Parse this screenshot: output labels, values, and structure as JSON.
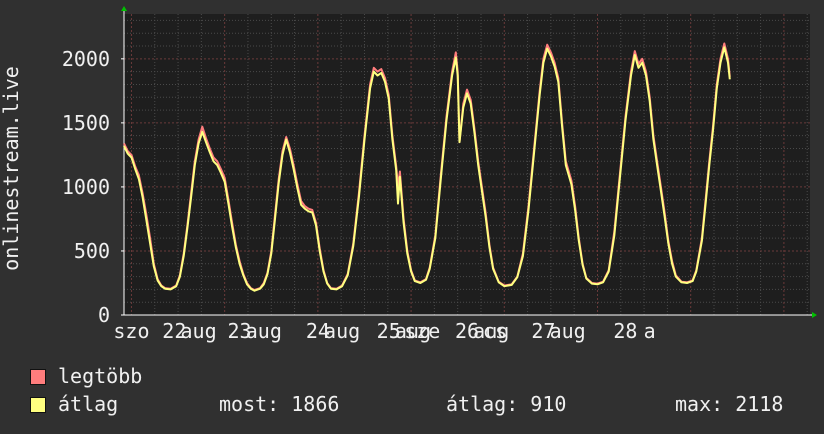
{
  "chart_data": {
    "type": "line",
    "ylabel": "onlinestream.live",
    "ylim": [
      0,
      2350
    ],
    "yticks": [
      0,
      500,
      1000,
      1500,
      2000
    ],
    "ytick_labels": [
      "0",
      "500",
      "1000",
      "1500",
      "2000"
    ],
    "x_range": [
      -0.08,
      7.28
    ],
    "x_tick_positions": [
      0,
      1,
      2,
      3,
      4,
      5,
      6,
      7
    ],
    "x_labels": [
      {
        "text": "szo",
        "at": 0.0
      },
      {
        "text": "22",
        "at": 0.46
      },
      {
        "text": "aug",
        "at": 0.72
      },
      {
        "text": "23",
        "at": 1.16
      },
      {
        "text": "aug",
        "at": 1.42
      },
      {
        "text": "24",
        "at": 2.0
      },
      {
        "text": "aug",
        "at": 2.26
      },
      {
        "text": "25",
        "at": 2.76
      },
      {
        "text": "aug",
        "at": 3.02
      },
      {
        "text": "sze",
        "at": 3.12
      },
      {
        "text": "26",
        "at": 3.6
      },
      {
        "text": "aug",
        "at": 3.86
      },
      {
        "text": "cs",
        "at": 3.9
      },
      {
        "text": "27",
        "at": 4.42
      },
      {
        "text": "aug",
        "at": 4.68
      },
      {
        "text": "28",
        "at": 5.3
      },
      {
        "text": "a",
        "at": 5.56
      }
    ],
    "series": [
      {
        "name": "legtöbb",
        "color": "#ff7d7d",
        "points": [
          [
            -0.08,
            1340
          ],
          [
            -0.04,
            1280
          ],
          [
            0.0,
            1250
          ],
          [
            0.04,
            1160
          ],
          [
            0.08,
            1090
          ],
          [
            0.12,
            950
          ],
          [
            0.16,
            780
          ],
          [
            0.2,
            600
          ],
          [
            0.24,
            400
          ],
          [
            0.28,
            280
          ],
          [
            0.32,
            230
          ],
          [
            0.36,
            210
          ],
          [
            0.42,
            205
          ],
          [
            0.48,
            230
          ],
          [
            0.52,
            310
          ],
          [
            0.56,
            480
          ],
          [
            0.6,
            700
          ],
          [
            0.64,
            950
          ],
          [
            0.68,
            1200
          ],
          [
            0.72,
            1370
          ],
          [
            0.76,
            1470
          ],
          [
            0.8,
            1380
          ],
          [
            0.84,
            1300
          ],
          [
            0.88,
            1230
          ],
          [
            0.92,
            1200
          ],
          [
            0.96,
            1140
          ],
          [
            1.0,
            1070
          ],
          [
            1.04,
            900
          ],
          [
            1.08,
            720
          ],
          [
            1.12,
            550
          ],
          [
            1.16,
            420
          ],
          [
            1.2,
            320
          ],
          [
            1.24,
            250
          ],
          [
            1.28,
            210
          ],
          [
            1.32,
            195
          ],
          [
            1.38,
            210
          ],
          [
            1.42,
            250
          ],
          [
            1.46,
            330
          ],
          [
            1.5,
            500
          ],
          [
            1.54,
            780
          ],
          [
            1.58,
            1060
          ],
          [
            1.62,
            1280
          ],
          [
            1.66,
            1390
          ],
          [
            1.7,
            1300
          ],
          [
            1.74,
            1170
          ],
          [
            1.78,
            1020
          ],
          [
            1.82,
            890
          ],
          [
            1.86,
            850
          ],
          [
            1.9,
            830
          ],
          [
            1.94,
            820
          ],
          [
            1.98,
            720
          ],
          [
            2.02,
            520
          ],
          [
            2.06,
            350
          ],
          [
            2.1,
            250
          ],
          [
            2.14,
            210
          ],
          [
            2.2,
            205
          ],
          [
            2.26,
            230
          ],
          [
            2.32,
            320
          ],
          [
            2.38,
            560
          ],
          [
            2.44,
            950
          ],
          [
            2.5,
            1400
          ],
          [
            2.56,
            1800
          ],
          [
            2.6,
            1930
          ],
          [
            2.64,
            1900
          ],
          [
            2.68,
            1920
          ],
          [
            2.72,
            1850
          ],
          [
            2.76,
            1720
          ],
          [
            2.8,
            1400
          ],
          [
            2.84,
            1160
          ],
          [
            2.86,
            1000
          ],
          [
            2.88,
            1120
          ],
          [
            2.92,
            750
          ],
          [
            2.96,
            500
          ],
          [
            3.0,
            350
          ],
          [
            3.04,
            270
          ],
          [
            3.1,
            255
          ],
          [
            3.16,
            280
          ],
          [
            3.2,
            370
          ],
          [
            3.26,
            620
          ],
          [
            3.32,
            1100
          ],
          [
            3.38,
            1550
          ],
          [
            3.44,
            1900
          ],
          [
            3.48,
            2050
          ],
          [
            3.5,
            1900
          ],
          [
            3.52,
            1350
          ],
          [
            3.56,
            1650
          ],
          [
            3.6,
            1760
          ],
          [
            3.64,
            1680
          ],
          [
            3.68,
            1450
          ],
          [
            3.72,
            1200
          ],
          [
            3.76,
            1000
          ],
          [
            3.8,
            800
          ],
          [
            3.84,
            550
          ],
          [
            3.88,
            370
          ],
          [
            3.94,
            260
          ],
          [
            4.0,
            230
          ],
          [
            4.08,
            240
          ],
          [
            4.14,
            300
          ],
          [
            4.2,
            480
          ],
          [
            4.26,
            850
          ],
          [
            4.32,
            1300
          ],
          [
            4.38,
            1750
          ],
          [
            4.42,
            2000
          ],
          [
            4.46,
            2110
          ],
          [
            4.5,
            2050
          ],
          [
            4.54,
            1970
          ],
          [
            4.58,
            1850
          ],
          [
            4.62,
            1500
          ],
          [
            4.66,
            1200
          ],
          [
            4.72,
            1050
          ],
          [
            4.76,
            850
          ],
          [
            4.8,
            600
          ],
          [
            4.84,
            400
          ],
          [
            4.88,
            290
          ],
          [
            4.94,
            250
          ],
          [
            5.0,
            245
          ],
          [
            5.06,
            260
          ],
          [
            5.12,
            350
          ],
          [
            5.18,
            650
          ],
          [
            5.24,
            1100
          ],
          [
            5.3,
            1550
          ],
          [
            5.36,
            1900
          ],
          [
            5.4,
            2060
          ],
          [
            5.44,
            1960
          ],
          [
            5.48,
            2000
          ],
          [
            5.52,
            1900
          ],
          [
            5.56,
            1700
          ],
          [
            5.6,
            1400
          ],
          [
            5.64,
            1200
          ],
          [
            5.68,
            1000
          ],
          [
            5.72,
            800
          ],
          [
            5.76,
            580
          ],
          [
            5.8,
            420
          ],
          [
            5.84,
            310
          ],
          [
            5.9,
            260
          ],
          [
            5.96,
            255
          ],
          [
            6.02,
            270
          ],
          [
            6.06,
            350
          ],
          [
            6.12,
            600
          ],
          [
            6.16,
            900
          ],
          [
            6.2,
            1200
          ],
          [
            6.24,
            1480
          ],
          [
            6.28,
            1800
          ],
          [
            6.32,
            2000
          ],
          [
            6.36,
            2120
          ],
          [
            6.4,
            2000
          ],
          [
            6.42,
            1860
          ]
        ]
      },
      {
        "name": "átlag",
        "color": "#ffff80",
        "points": [
          [
            -0.08,
            1320
          ],
          [
            -0.04,
            1260
          ],
          [
            0.0,
            1230
          ],
          [
            0.04,
            1140
          ],
          [
            0.08,
            1060
          ],
          [
            0.12,
            920
          ],
          [
            0.16,
            740
          ],
          [
            0.2,
            560
          ],
          [
            0.24,
            380
          ],
          [
            0.28,
            270
          ],
          [
            0.32,
            225
          ],
          [
            0.36,
            205
          ],
          [
            0.42,
            200
          ],
          [
            0.48,
            225
          ],
          [
            0.52,
            300
          ],
          [
            0.56,
            460
          ],
          [
            0.6,
            680
          ],
          [
            0.64,
            920
          ],
          [
            0.68,
            1170
          ],
          [
            0.72,
            1340
          ],
          [
            0.76,
            1430
          ],
          [
            0.8,
            1350
          ],
          [
            0.84,
            1270
          ],
          [
            0.88,
            1200
          ],
          [
            0.92,
            1170
          ],
          [
            0.96,
            1110
          ],
          [
            1.0,
            1040
          ],
          [
            1.04,
            870
          ],
          [
            1.08,
            690
          ],
          [
            1.12,
            530
          ],
          [
            1.16,
            400
          ],
          [
            1.2,
            310
          ],
          [
            1.24,
            240
          ],
          [
            1.28,
            205
          ],
          [
            1.32,
            190
          ],
          [
            1.38,
            205
          ],
          [
            1.42,
            240
          ],
          [
            1.46,
            320
          ],
          [
            1.5,
            480
          ],
          [
            1.54,
            750
          ],
          [
            1.58,
            1030
          ],
          [
            1.62,
            1250
          ],
          [
            1.66,
            1370
          ],
          [
            1.7,
            1270
          ],
          [
            1.74,
            1140
          ],
          [
            1.78,
            990
          ],
          [
            1.82,
            860
          ],
          [
            1.86,
            830
          ],
          [
            1.9,
            810
          ],
          [
            1.94,
            800
          ],
          [
            1.98,
            700
          ],
          [
            2.02,
            500
          ],
          [
            2.06,
            340
          ],
          [
            2.1,
            245
          ],
          [
            2.14,
            205
          ],
          [
            2.2,
            200
          ],
          [
            2.26,
            225
          ],
          [
            2.32,
            310
          ],
          [
            2.38,
            540
          ],
          [
            2.44,
            920
          ],
          [
            2.5,
            1370
          ],
          [
            2.56,
            1770
          ],
          [
            2.6,
            1900
          ],
          [
            2.64,
            1870
          ],
          [
            2.68,
            1890
          ],
          [
            2.72,
            1820
          ],
          [
            2.76,
            1690
          ],
          [
            2.8,
            1370
          ],
          [
            2.84,
            1130
          ],
          [
            2.86,
            870
          ],
          [
            2.88,
            1080
          ],
          [
            2.92,
            720
          ],
          [
            2.96,
            480
          ],
          [
            3.0,
            340
          ],
          [
            3.04,
            265
          ],
          [
            3.1,
            250
          ],
          [
            3.16,
            275
          ],
          [
            3.2,
            360
          ],
          [
            3.26,
            600
          ],
          [
            3.32,
            1070
          ],
          [
            3.38,
            1520
          ],
          [
            3.44,
            1870
          ],
          [
            3.48,
            2010
          ],
          [
            3.5,
            1870
          ],
          [
            3.52,
            1350
          ],
          [
            3.56,
            1620
          ],
          [
            3.6,
            1730
          ],
          [
            3.64,
            1650
          ],
          [
            3.68,
            1420
          ],
          [
            3.72,
            1170
          ],
          [
            3.76,
            970
          ],
          [
            3.8,
            770
          ],
          [
            3.84,
            530
          ],
          [
            3.88,
            360
          ],
          [
            3.94,
            255
          ],
          [
            4.0,
            225
          ],
          [
            4.08,
            235
          ],
          [
            4.14,
            295
          ],
          [
            4.2,
            460
          ],
          [
            4.26,
            820
          ],
          [
            4.32,
            1270
          ],
          [
            4.38,
            1720
          ],
          [
            4.42,
            1970
          ],
          [
            4.46,
            2080
          ],
          [
            4.5,
            2020
          ],
          [
            4.54,
            1940
          ],
          [
            4.58,
            1820
          ],
          [
            4.62,
            1470
          ],
          [
            4.66,
            1170
          ],
          [
            4.72,
            1020
          ],
          [
            4.76,
            820
          ],
          [
            4.8,
            580
          ],
          [
            4.84,
            390
          ],
          [
            4.88,
            285
          ],
          [
            4.94,
            245
          ],
          [
            5.0,
            240
          ],
          [
            5.06,
            255
          ],
          [
            5.12,
            340
          ],
          [
            5.18,
            620
          ],
          [
            5.24,
            1070
          ],
          [
            5.3,
            1520
          ],
          [
            5.36,
            1870
          ],
          [
            5.4,
            2030
          ],
          [
            5.44,
            1930
          ],
          [
            5.48,
            1970
          ],
          [
            5.52,
            1870
          ],
          [
            5.56,
            1670
          ],
          [
            5.6,
            1370
          ],
          [
            5.64,
            1170
          ],
          [
            5.68,
            970
          ],
          [
            5.72,
            770
          ],
          [
            5.76,
            560
          ],
          [
            5.8,
            400
          ],
          [
            5.84,
            300
          ],
          [
            5.9,
            255
          ],
          [
            5.96,
            250
          ],
          [
            6.02,
            265
          ],
          [
            6.06,
            340
          ],
          [
            6.12,
            580
          ],
          [
            6.16,
            870
          ],
          [
            6.2,
            1170
          ],
          [
            6.24,
            1450
          ],
          [
            6.28,
            1770
          ],
          [
            6.32,
            1970
          ],
          [
            6.36,
            2090
          ],
          [
            6.4,
            1970
          ],
          [
            6.42,
            1840
          ]
        ]
      }
    ],
    "legend_placement": "bottom-left"
  },
  "legend": {
    "items": [
      {
        "label": "legtöbb",
        "color": "#ff7d7d"
      },
      {
        "label": "átlag",
        "color": "#ffff80"
      }
    ],
    "stats": {
      "now": "most: 1866",
      "avg": "átlag: 910",
      "max": "max: 2118"
    }
  }
}
